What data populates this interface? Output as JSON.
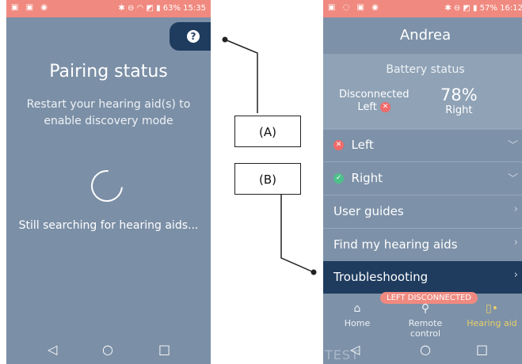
{
  "left_screen": {
    "status_time": "15:35",
    "status_battery": "63%",
    "help_icon": "question-circle-icon",
    "title": "Pairing status",
    "subtitle_line1": "Restart your hearing aid(s) to",
    "subtitle_line2": "enable discovery mode",
    "searching_text": "Still searching for hearing aids..."
  },
  "right_screen": {
    "status_time": "16:12",
    "status_battery": "57%",
    "user_name": "Andrea",
    "battery_title": "Battery status",
    "left_status": "Disconnected",
    "left_label": "Left",
    "right_percent": "78%",
    "right_label": "Right",
    "menu": [
      {
        "label": "Left",
        "icon": "x-circle-icon",
        "chevron": "chevron-down-icon"
      },
      {
        "label": "Right",
        "icon": "check-circle-icon",
        "chevron": "chevron-down-icon"
      },
      {
        "label": "User guides",
        "chevron": "chevron-right-icon"
      },
      {
        "label": "Find my hearing aids",
        "chevron": "chevron-right-icon"
      },
      {
        "label": "Troubleshooting",
        "chevron": "chevron-right-icon"
      }
    ],
    "badge": "LEFT DISCONNECTED",
    "tabs": [
      {
        "label": "Home",
        "icon": "home-icon"
      },
      {
        "label": "Remote control",
        "icon": "remote-icon"
      },
      {
        "label": "Hearing aid",
        "icon": "hearing-aid-icon"
      }
    ],
    "watermark": "TEST"
  },
  "annotations": {
    "label_a": "(A)",
    "label_b": "(B)"
  },
  "colors": {
    "screen_bg": "#7b8fa6",
    "accent_dark": "#1f3c5f",
    "status_bar": "#f08a80",
    "selected_tab": "#e8d06a"
  }
}
